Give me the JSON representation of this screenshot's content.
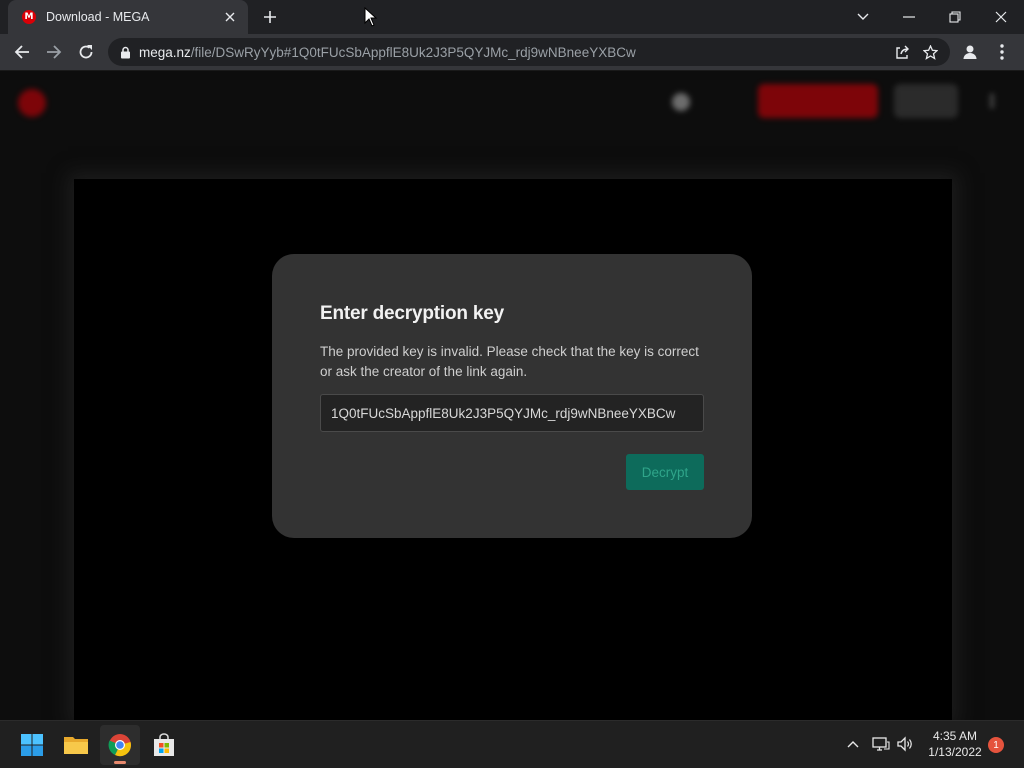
{
  "browser": {
    "tab_title": "Download - MEGA",
    "favicon_letter": "M",
    "url_host": "mega.nz",
    "url_path": "/file/DSwRyYyb#1Q0tFUcSbAppflE8Uk2J3P5QYJMc_rdj9wNBneeYXBCw"
  },
  "dialog": {
    "title": "Enter decryption key",
    "message": "The provided key is invalid. Please check that the key is correct or ask the creator of the link again.",
    "key_value": "1Q0tFUcSbAppflE8Uk2J3P5QYJMc_rdj9wNBneeYXBCw",
    "decrypt_label": "Decrypt"
  },
  "taskbar": {
    "time": "4:35 AM",
    "date": "1/13/2022",
    "notification_count": "1"
  },
  "colors": {
    "mega_red": "#d90007",
    "dialog_bg": "#333333",
    "decrypt_bg": "#0d6b5b"
  }
}
